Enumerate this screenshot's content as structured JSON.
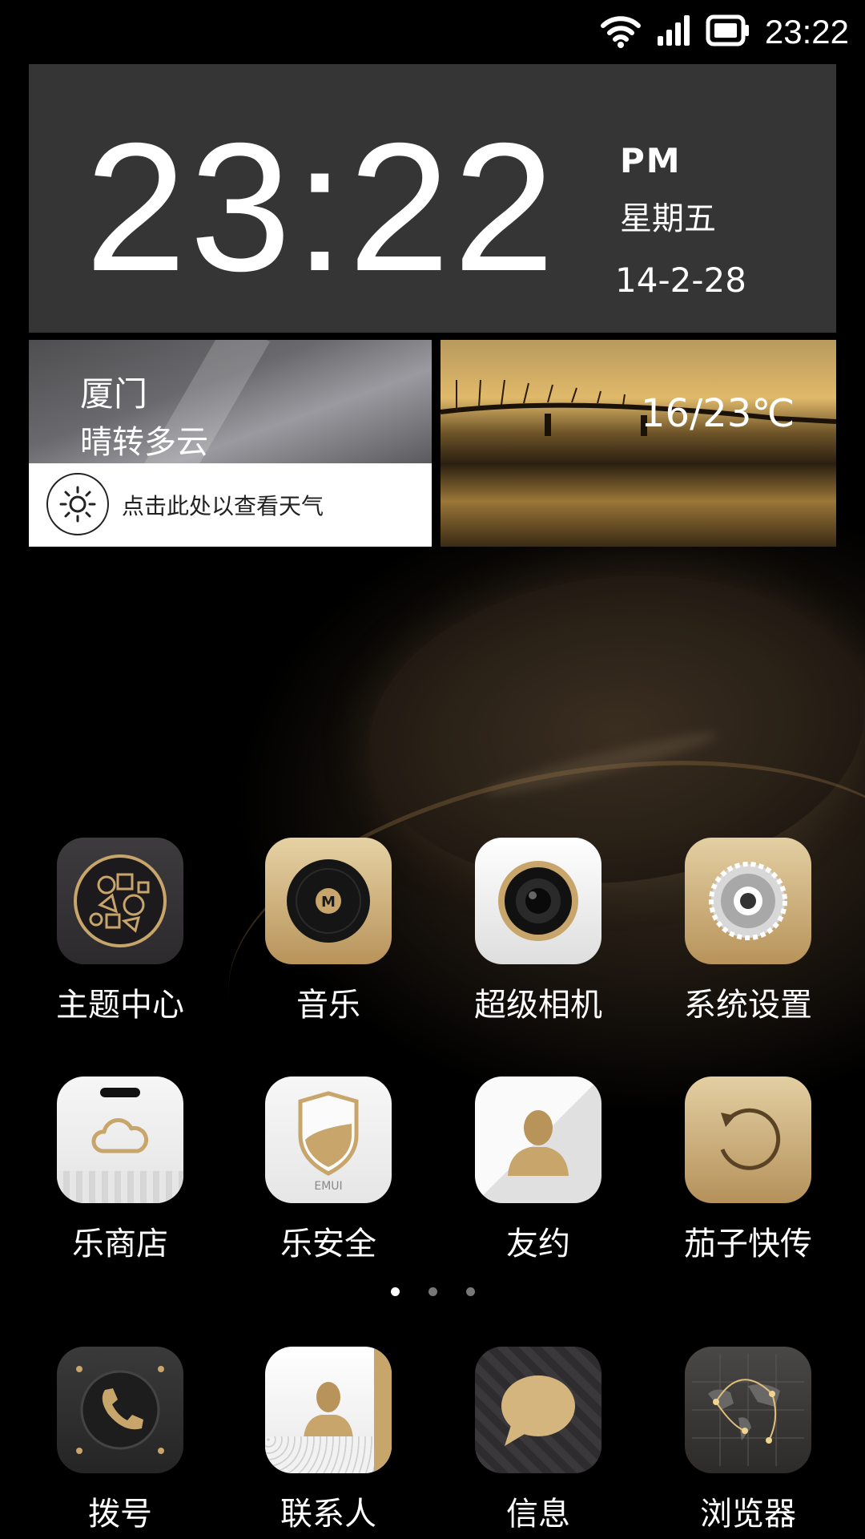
{
  "status_bar": {
    "time": "23:22",
    "icons": [
      "wifi-icon",
      "signal-icon",
      "battery-icon"
    ]
  },
  "clock_widget": {
    "time": "23:22",
    "ampm": "PM",
    "weekday": "星期五",
    "date": "14-2-28"
  },
  "weather": {
    "city": "厦门",
    "condition": "晴转多云",
    "hint": "点击此处以查看天气",
    "temperature": "16/23℃"
  },
  "apps": [
    {
      "label": "主题中心",
      "icon": "theme-center-icon"
    },
    {
      "label": "音乐",
      "icon": "music-icon"
    },
    {
      "label": "超级相机",
      "icon": "camera-icon"
    },
    {
      "label": "系统设置",
      "icon": "settings-gear-icon"
    },
    {
      "label": "乐商店",
      "icon": "store-cloud-icon"
    },
    {
      "label": "乐安全",
      "icon": "security-shield-icon",
      "badge_text": "EMUI"
    },
    {
      "label": "友约",
      "icon": "person-icon"
    },
    {
      "label": "茄子快传",
      "icon": "transfer-icon"
    }
  ],
  "page_indicator": {
    "count": 3,
    "active": 1
  },
  "dock": [
    {
      "label": "拨号",
      "icon": "phone-icon"
    },
    {
      "label": "联系人",
      "icon": "contacts-icon"
    },
    {
      "label": "信息",
      "icon": "message-bubble-icon"
    },
    {
      "label": "浏览器",
      "icon": "globe-map-icon"
    }
  ],
  "colors": {
    "clock_bg": "#353535",
    "gold": "#c7a56b",
    "dot_inactive": "#777777"
  }
}
